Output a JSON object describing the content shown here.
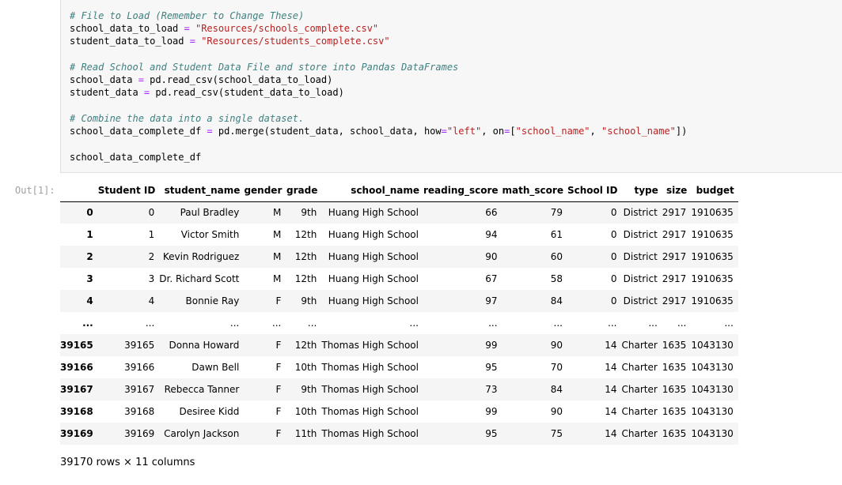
{
  "code_cell": {
    "lines": [
      {
        "kind": "comment",
        "text": "# File to Load (Remember to Change These)"
      },
      {
        "kind": "assign",
        "lhs": "school_data_to_load",
        "op": " = ",
        "rhs": "\"Resources/schools_complete.csv\""
      },
      {
        "kind": "assign",
        "lhs": "student_data_to_load",
        "op": " = ",
        "rhs": "\"Resources/students_complete.csv\""
      },
      {
        "kind": "comment",
        "text": "# Read School and Student Data File and store into Pandas DataFrames"
      },
      {
        "kind": "plain",
        "lhs": "school_data",
        "op": " = ",
        "rest": "pd.read_csv(school_data_to_load)"
      },
      {
        "kind": "plain",
        "lhs": "student_data",
        "op": " = ",
        "rest": "pd.read_csv(student_data_to_load)"
      },
      {
        "kind": "comment",
        "text": "# Combine the data into a single dataset."
      },
      {
        "kind": "merge",
        "lhs": "school_data_complete_df",
        "op": " = ",
        "rest1": "pd.merge(student_data, school_data, how",
        "op2": "=",
        "str1": "\"left\"",
        "rest2": ", on",
        "op3": "=",
        "rest3": "[",
        "str2": "\"school_name\"",
        "rest4": ", ",
        "str3": "\"school_name\"",
        "rest5": "])"
      },
      {
        "kind": "plain_only",
        "text": "school_data_complete_df"
      }
    ]
  },
  "output": {
    "prompt": "Out[1]:",
    "columns": [
      "",
      "Student ID",
      "student_name",
      "gender",
      "grade",
      "school_name",
      "reading_score",
      "math_score",
      "School ID",
      "type",
      "size",
      "budget"
    ],
    "rows": [
      [
        "0",
        "0",
        "Paul Bradley",
        "M",
        "9th",
        "Huang High School",
        "66",
        "79",
        "0",
        "District",
        "2917",
        "1910635"
      ],
      [
        "1",
        "1",
        "Victor Smith",
        "M",
        "12th",
        "Huang High School",
        "94",
        "61",
        "0",
        "District",
        "2917",
        "1910635"
      ],
      [
        "2",
        "2",
        "Kevin Rodriguez",
        "M",
        "12th",
        "Huang High School",
        "90",
        "60",
        "0",
        "District",
        "2917",
        "1910635"
      ],
      [
        "3",
        "3",
        "Dr. Richard Scott",
        "M",
        "12th",
        "Huang High School",
        "67",
        "58",
        "0",
        "District",
        "2917",
        "1910635"
      ],
      [
        "4",
        "4",
        "Bonnie Ray",
        "F",
        "9th",
        "Huang High School",
        "97",
        "84",
        "0",
        "District",
        "2917",
        "1910635"
      ],
      [
        "...",
        "...",
        "...",
        "...",
        "...",
        "...",
        "...",
        "...",
        "...",
        "...",
        "...",
        "..."
      ],
      [
        "39165",
        "39165",
        "Donna Howard",
        "F",
        "12th",
        "Thomas High School",
        "99",
        "90",
        "14",
        "Charter",
        "1635",
        "1043130"
      ],
      [
        "39166",
        "39166",
        "Dawn Bell",
        "F",
        "10th",
        "Thomas High School",
        "95",
        "70",
        "14",
        "Charter",
        "1635",
        "1043130"
      ],
      [
        "39167",
        "39167",
        "Rebecca Tanner",
        "F",
        "9th",
        "Thomas High School",
        "73",
        "84",
        "14",
        "Charter",
        "1635",
        "1043130"
      ],
      [
        "39168",
        "39168",
        "Desiree Kidd",
        "F",
        "10th",
        "Thomas High School",
        "99",
        "90",
        "14",
        "Charter",
        "1635",
        "1043130"
      ],
      [
        "39169",
        "39169",
        "Carolyn Jackson",
        "F",
        "11th",
        "Thomas High School",
        "95",
        "75",
        "14",
        "Charter",
        "1635",
        "1043130"
      ]
    ],
    "shape_text": "39170 rows × 11 columns"
  }
}
